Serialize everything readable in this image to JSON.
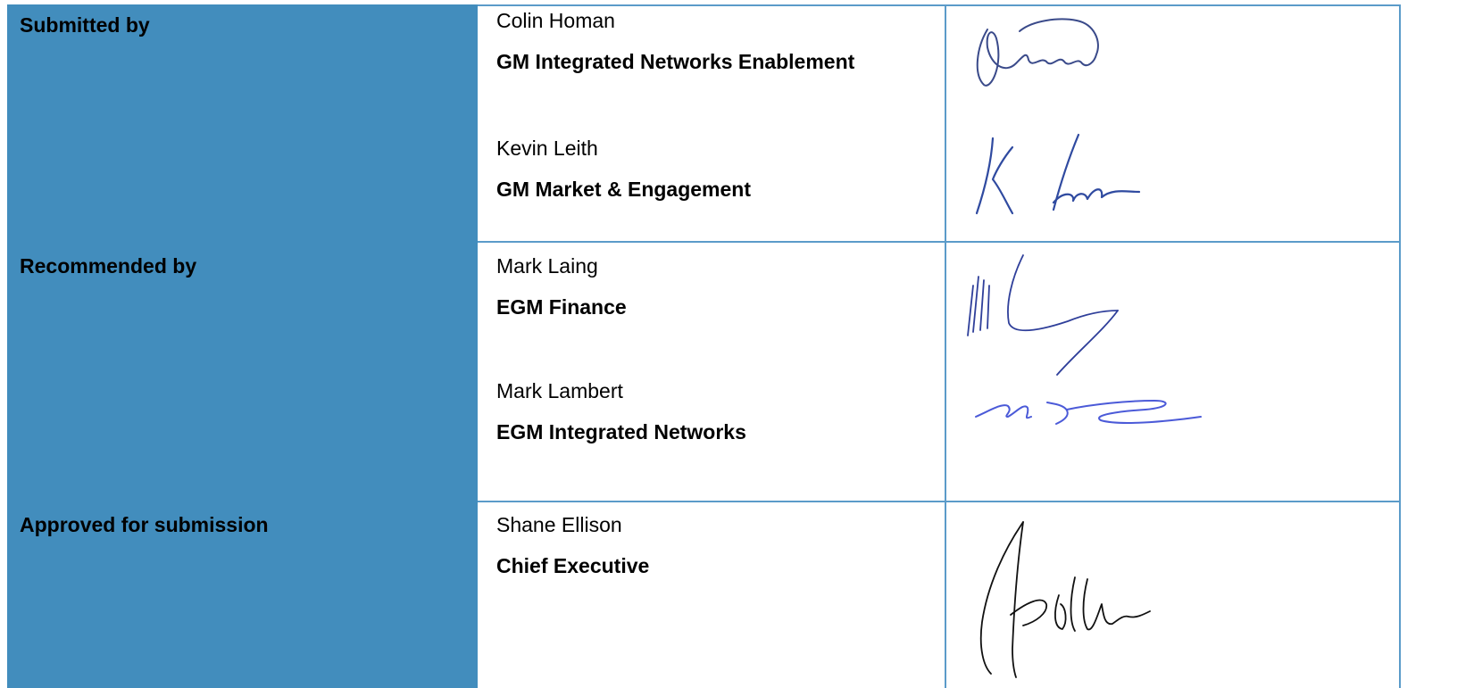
{
  "sections": [
    {
      "label": "Submitted by",
      "people": [
        {
          "name": "Colin Homan",
          "title": "GM Integrated Networks Enablement",
          "signature_text": "Homan"
        },
        {
          "name": "Kevin Leith",
          "title": "GM Market & Engagement",
          "signature_text": "K Leith"
        }
      ]
    },
    {
      "label": "Recommended by",
      "people": [
        {
          "name": "Mark Laing",
          "title": "EGM Finance",
          "signature_text": "M Laing"
        },
        {
          "name": "Mark Lambert",
          "title": "EGM Integrated Networks",
          "signature_text": "M Lambert"
        }
      ]
    },
    {
      "label": "Approved for submission",
      "people": [
        {
          "name": "Shane Ellison",
          "title": "Chief Executive",
          "signature_text": "S Ellison"
        }
      ]
    }
  ],
  "colors": {
    "label_bg": "#428dbd",
    "grid_line": "#5b9bc9",
    "signature_ink": "#2f3f9a"
  }
}
